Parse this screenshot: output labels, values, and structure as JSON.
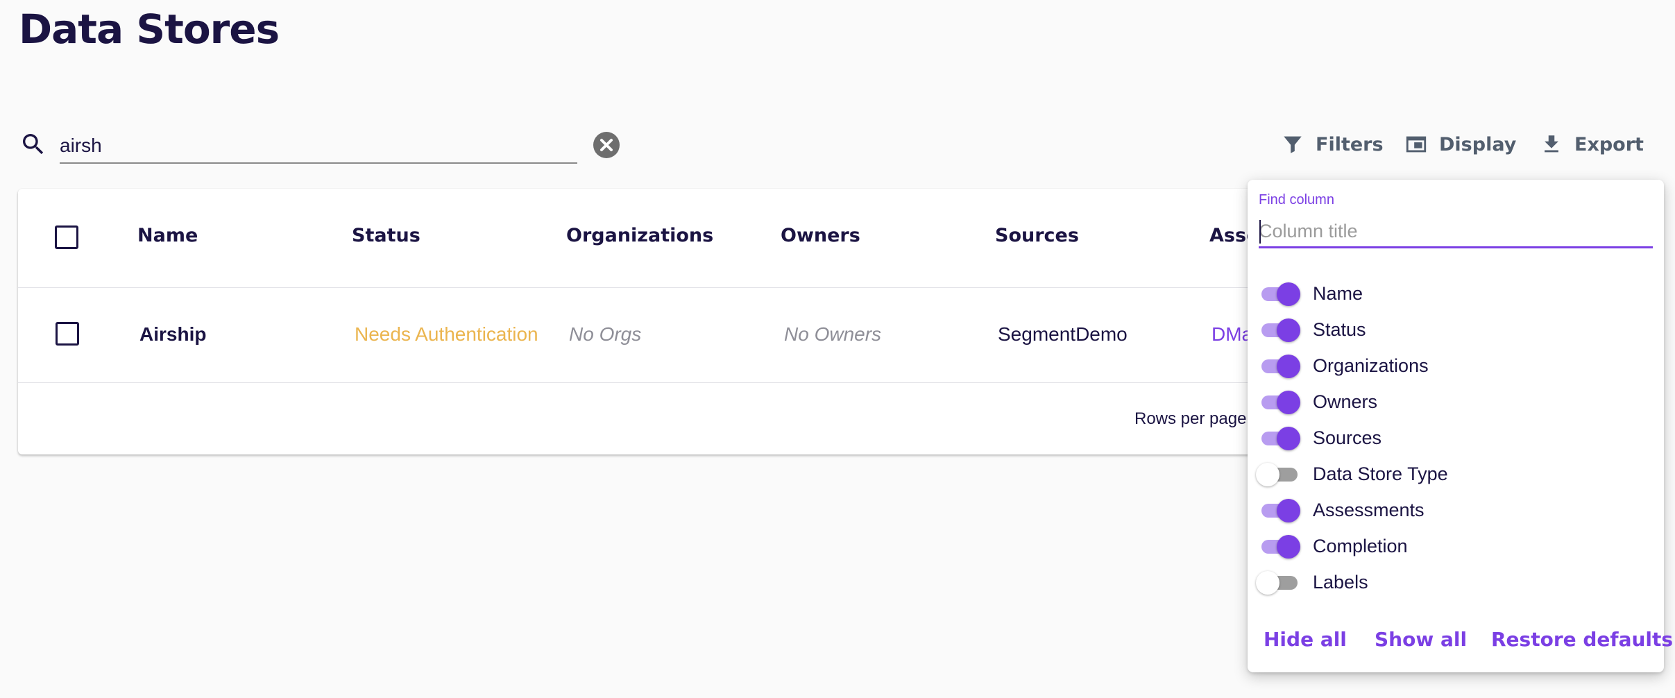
{
  "page": {
    "title": "Data Stores"
  },
  "search": {
    "value": "airsh",
    "icon": "search-icon",
    "clear_icon": "clear-circle-icon"
  },
  "toolbar": {
    "filters_label": "Filters",
    "display_label": "Display",
    "export_label": "Export",
    "icon_color": "#525e6e"
  },
  "table": {
    "columns": [
      "Name",
      "Status",
      "Organizations",
      "Owners",
      "Sources",
      "Asse"
    ],
    "rows": [
      {
        "name": "Airship",
        "status": "Needs Authentication",
        "organizations": "No Orgs",
        "owners": "No Owners",
        "sources": "SegmentDemo",
        "assessments": "DMa"
      }
    ],
    "status_color": "#ebb54f",
    "pagination": {
      "rows_per_page_label": "Rows per page:"
    }
  },
  "column_picker": {
    "find_label": "Find column",
    "find_placeholder": "Column title",
    "accent_color": "#7b3fe4",
    "items": [
      {
        "label": "Name",
        "enabled": true
      },
      {
        "label": "Status",
        "enabled": true
      },
      {
        "label": "Organizations",
        "enabled": true
      },
      {
        "label": "Owners",
        "enabled": true
      },
      {
        "label": "Sources",
        "enabled": true
      },
      {
        "label": "Data Store Type",
        "enabled": false
      },
      {
        "label": "Assessments",
        "enabled": true
      },
      {
        "label": "Completion",
        "enabled": true
      },
      {
        "label": "Labels",
        "enabled": false
      }
    ],
    "hide_all_label": "Hide all",
    "show_all_label": "Show all",
    "restore_label": "Restore defaults"
  }
}
